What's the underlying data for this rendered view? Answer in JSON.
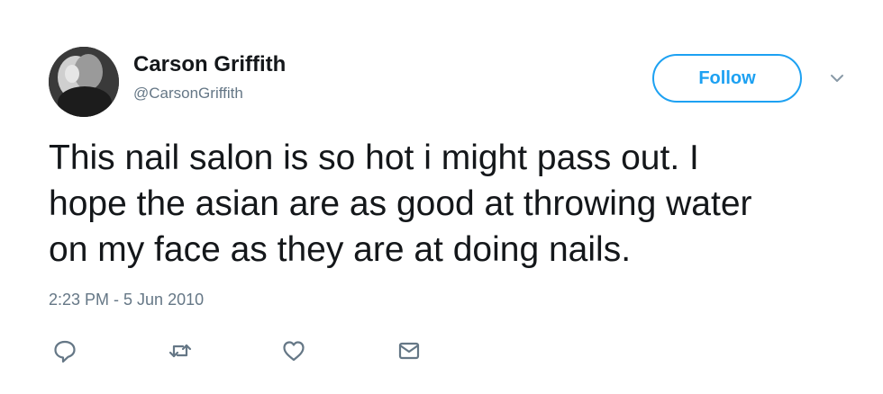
{
  "user": {
    "display_name": "Carson Griffith",
    "handle": "@CarsonGriffith",
    "avatar_icon": "profile-photo"
  },
  "header": {
    "follow_label": "Follow",
    "more_icon": "chevron-down-icon"
  },
  "tweet": {
    "text": "This nail salon is so hot i might pass out. I\nhope the asian are as good at throwing water\non my face as they are at doing nails.",
    "timestamp": "2:23 PM - 5 Jun 2010"
  },
  "actions": {
    "items": [
      {
        "icon": "reply-icon"
      },
      {
        "icon": "retweet-icon"
      },
      {
        "icon": "like-icon"
      },
      {
        "icon": "direct-message-icon"
      }
    ]
  },
  "colors": {
    "accent": "#1da1f2",
    "text": "#14171a",
    "muted": "#657786",
    "background": "#ffffff"
  }
}
